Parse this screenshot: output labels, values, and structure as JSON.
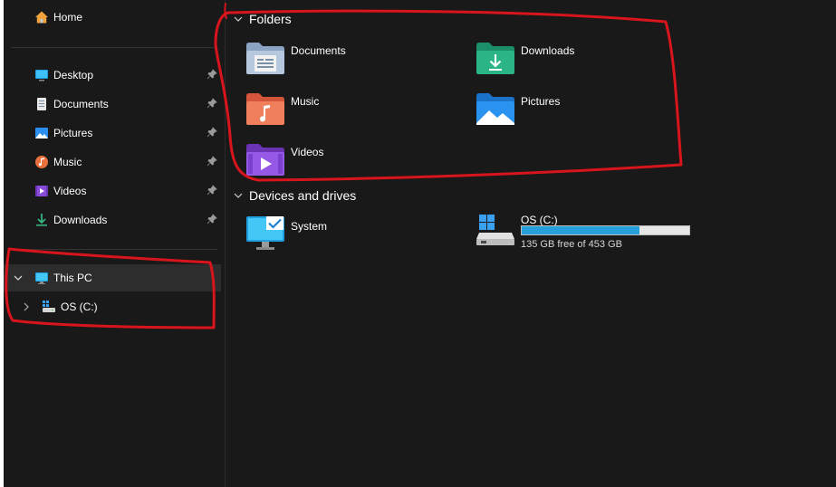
{
  "sidebar": {
    "home_label": "Home",
    "quick_access": [
      {
        "label": "Desktop",
        "icon": "desktop-icon"
      },
      {
        "label": "Documents",
        "icon": "documents-icon"
      },
      {
        "label": "Pictures",
        "icon": "pictures-icon"
      },
      {
        "label": "Music",
        "icon": "music-icon"
      },
      {
        "label": "Videos",
        "icon": "videos-icon"
      },
      {
        "label": "Downloads",
        "icon": "downloads-icon"
      }
    ],
    "this_pc_label": "This PC",
    "os_drive_label": "OS (C:)"
  },
  "main": {
    "folders_header": "Folders",
    "folders": [
      {
        "label": "Documents",
        "icon": "documents-folder-icon"
      },
      {
        "label": "Downloads",
        "icon": "downloads-folder-icon"
      },
      {
        "label": "Music",
        "icon": "music-folder-icon"
      },
      {
        "label": "Pictures",
        "icon": "pictures-folder-icon"
      },
      {
        "label": "Videos",
        "icon": "videos-folder-icon"
      }
    ],
    "devices_header": "Devices and drives",
    "system_label": "System",
    "drive": {
      "label": "OS (C:)",
      "free_text": "135 GB free of 453 GB",
      "used_fraction": 0.702
    }
  },
  "colors": {
    "background": "#191919",
    "selected": "#2d2d2d",
    "drive_fill": "#26a0da",
    "annotation": "#d8141c"
  }
}
